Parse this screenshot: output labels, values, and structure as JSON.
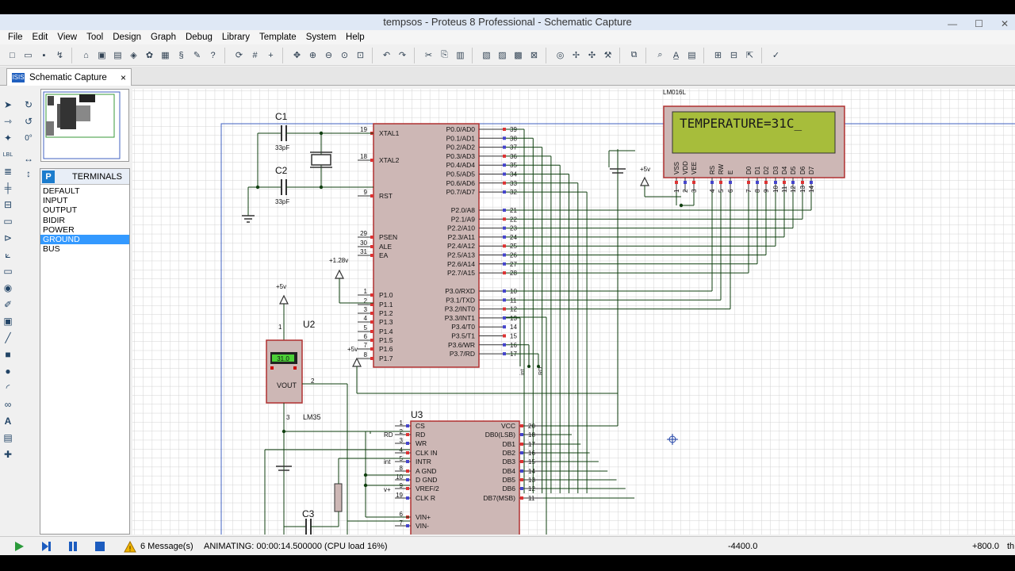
{
  "window": {
    "title": "tempsos - Proteus 8 Professional - Schematic Capture"
  },
  "menu": [
    "File",
    "Edit",
    "View",
    "Tool",
    "Design",
    "Graph",
    "Debug",
    "Library",
    "Template",
    "System",
    "Help"
  ],
  "tab": {
    "label": "Schematic Capture",
    "icon_text": "ISIS",
    "close": "×"
  },
  "rotation": "0°",
  "terminals_panel": {
    "badge": "P",
    "title": "TERMINALS",
    "items": [
      "DEFAULT",
      "INPUT",
      "OUTPUT",
      "BIDIR",
      "POWER",
      "GROUND",
      "BUS"
    ],
    "selected": "GROUND"
  },
  "schematic": {
    "lcd": {
      "part": "LM016L",
      "text": "TEMPERATURE=31C_",
      "pins": [
        "VSS",
        "VDD",
        "VEE",
        "RS",
        "RW",
        "E",
        "D0",
        "D1",
        "D2",
        "D3",
        "D4",
        "D5",
        "D6",
        "D7"
      ],
      "pin_numbers": [
        "1",
        "2",
        "3",
        "4",
        "5",
        "6",
        "7",
        "8",
        "9",
        "10",
        "11",
        "12",
        "13",
        "14"
      ],
      "supply": "+5v"
    },
    "c1": {
      "ref": "C1",
      "value": "33pF"
    },
    "c2": {
      "ref": "C2",
      "value": "33pF"
    },
    "c3": {
      "ref": "C3"
    },
    "mcu": {
      "left_pins": [
        {
          "num": "19",
          "name": "XTAL1"
        },
        {
          "num": "18",
          "name": "XTAL2"
        },
        {
          "num": "9",
          "name": "RST"
        },
        {
          "num": "29",
          "name": "PSEN"
        },
        {
          "num": "30",
          "name": "ALE"
        },
        {
          "num": "31",
          "name": "EA"
        },
        {
          "num": "1",
          "name": "P1.0"
        },
        {
          "num": "2",
          "name": "P1.1"
        },
        {
          "num": "3",
          "name": "P1.2"
        },
        {
          "num": "4",
          "name": "P1.3"
        },
        {
          "num": "5",
          "name": "P1.4"
        },
        {
          "num": "6",
          "name": "P1.5"
        },
        {
          "num": "7",
          "name": "P1.6"
        },
        {
          "num": "8",
          "name": "P1.7"
        }
      ],
      "right_pins": [
        {
          "num": "39",
          "name": "P0.0/AD0"
        },
        {
          "num": "38",
          "name": "P0.1/AD1"
        },
        {
          "num": "37",
          "name": "P0.2/AD2"
        },
        {
          "num": "36",
          "name": "P0.3/AD3"
        },
        {
          "num": "35",
          "name": "P0.4/AD4"
        },
        {
          "num": "34",
          "name": "P0.5/AD5"
        },
        {
          "num": "33",
          "name": "P0.6/AD6"
        },
        {
          "num": "32",
          "name": "P0.7/AD7"
        },
        {
          "num": "21",
          "name": "P2.0/A8"
        },
        {
          "num": "22",
          "name": "P2.1/A9"
        },
        {
          "num": "23",
          "name": "P2.2/A10"
        },
        {
          "num": "24",
          "name": "P2.3/A11"
        },
        {
          "num": "25",
          "name": "P2.4/A12"
        },
        {
          "num": "26",
          "name": "P2.5/A13"
        },
        {
          "num": "27",
          "name": "P2.6/A14"
        },
        {
          "num": "28",
          "name": "P2.7/A15"
        },
        {
          "num": "10",
          "name": "P3.0/RXD"
        },
        {
          "num": "11",
          "name": "P3.1/TXD"
        },
        {
          "num": "12",
          "name": "P3.2/INT0"
        },
        {
          "num": "13",
          "name": "P3.3/INT1"
        },
        {
          "num": "14",
          "name": "P3.4/T0"
        },
        {
          "num": "15",
          "name": "P3.5/T1"
        },
        {
          "num": "16",
          "name": "P3.6/WR"
        },
        {
          "num": "17",
          "name": "P3.7/RD"
        }
      ],
      "ea_voltage": "+1.28v",
      "p16_supply": "+5v"
    },
    "u2": {
      "ref": "U2",
      "part": "LM35",
      "reading": "31.0",
      "pin_vout": "VOUT",
      "supply": "+5v",
      "pin_supply": "1",
      "pin_out": "2",
      "pin_gnd": "3"
    },
    "u3": {
      "ref": "U3",
      "left_pins": [
        {
          "num": "1",
          "name": "CS"
        },
        {
          "num": "2",
          "name": "RD"
        },
        {
          "num": "3",
          "name": "WR"
        },
        {
          "num": "4",
          "name": "CLK IN"
        },
        {
          "num": "5",
          "name": "INTR"
        },
        {
          "num": "8",
          "name": "A GND"
        },
        {
          "num": "10",
          "name": "D GND"
        },
        {
          "num": "9",
          "name": "VREF/2"
        },
        {
          "num": "19",
          "name": "CLK R"
        },
        {
          "num": "6",
          "name": "VIN+"
        },
        {
          "num": "7",
          "name": "VIN-"
        }
      ],
      "right_pins": [
        {
          "num": "20",
          "name": "VCC"
        },
        {
          "num": "18",
          "name": "DB0(LSB)"
        },
        {
          "num": "17",
          "name": "DB1"
        },
        {
          "num": "16",
          "name": "DB2"
        },
        {
          "num": "15",
          "name": "DB3"
        },
        {
          "num": "14",
          "name": "DB4"
        },
        {
          "num": "13",
          "name": "DB5"
        },
        {
          "num": "12",
          "name": "DB6"
        },
        {
          "num": "11",
          "name": "DB7(MSB)"
        }
      ],
      "net_labels": [
        "RD",
        "int",
        "v+"
      ]
    },
    "net_labels_mcu": [
      "int",
      "RD"
    ]
  },
  "status": {
    "messages": "6 Message(s)",
    "animating": "ANIMATING: 00:00:14.500000 (CPU load 16%)",
    "coord_x": "-4400.0",
    "coord_y": "+800.0",
    "units": "th"
  },
  "colors": {
    "lcd_bg": "#a7bd3b",
    "component_fill": "#cdb7b5",
    "component_border": "#b03030",
    "wire": "#0f3f0f",
    "grid": "#d6d6d6",
    "sheet_border": "#4060c0",
    "selected": "#3399ff"
  }
}
